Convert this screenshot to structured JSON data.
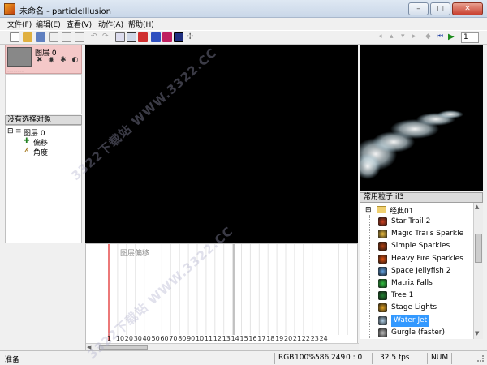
{
  "window": {
    "title": "未命名 - particleIllusion",
    "min_label": "–",
    "max_label": "□",
    "close_label": "✕"
  },
  "menu": [
    "文件(F)",
    "编辑(E)",
    "查看(V)",
    "动作(A)",
    "帮助(H)"
  ],
  "transport": {
    "frame_value": "1"
  },
  "layer": {
    "name": "图层 0",
    "icons": "✖ ◉ ✱ ◐",
    "dashes": "--------"
  },
  "object_panel": {
    "header": "没有选择对象",
    "tree": {
      "root": "图层 0",
      "children": [
        "偏移",
        "角度"
      ]
    }
  },
  "particles": {
    "header": "常用粒子.il3",
    "folder": "经典01",
    "items": [
      {
        "label": "Star Trail 2",
        "color": "#d04020"
      },
      {
        "label": "Magic Trails Sparkle",
        "color": "#f0c040"
      },
      {
        "label": "Simple Sparkles",
        "color": "#b04010"
      },
      {
        "label": "Heavy Fire Sparkles",
        "color": "#e05010"
      },
      {
        "label": "Space Jellyfish 2",
        "color": "#60a0e0"
      },
      {
        "label": "Matrix Falls",
        "color": "#30c040"
      },
      {
        "label": "Tree 1",
        "color": "#208030"
      },
      {
        "label": "Stage Lights",
        "color": "#e0a020"
      },
      {
        "label": "Water Jet",
        "color": "#b0d0e8",
        "selected": true
      },
      {
        "label": "Gurgle (faster)",
        "color": "#c0c0c0"
      }
    ]
  },
  "timeline": {
    "track_label": "图层偏移",
    "ticks": [
      "1",
      "10",
      "20",
      "30",
      "40",
      "50",
      "60",
      "70",
      "80",
      "90",
      "10",
      "11",
      "12",
      "13",
      "14",
      "15",
      "16",
      "17",
      "18",
      "19",
      "20",
      "21",
      "22",
      "23",
      "24"
    ]
  },
  "status": {
    "ready": "准备",
    "rgb": "RGB",
    "rgb_value": "100%",
    "coords": "586,249",
    "zero": "0 : 0",
    "fps": "32.5 fps",
    "num": "NUM"
  },
  "watermark": "3322下载站 WWW.3322.CC",
  "colors": {
    "canvas": "#000000",
    "layer_panel": "#f4c8c8",
    "selected_item": "#3399ff",
    "playhead": "#e02020"
  }
}
